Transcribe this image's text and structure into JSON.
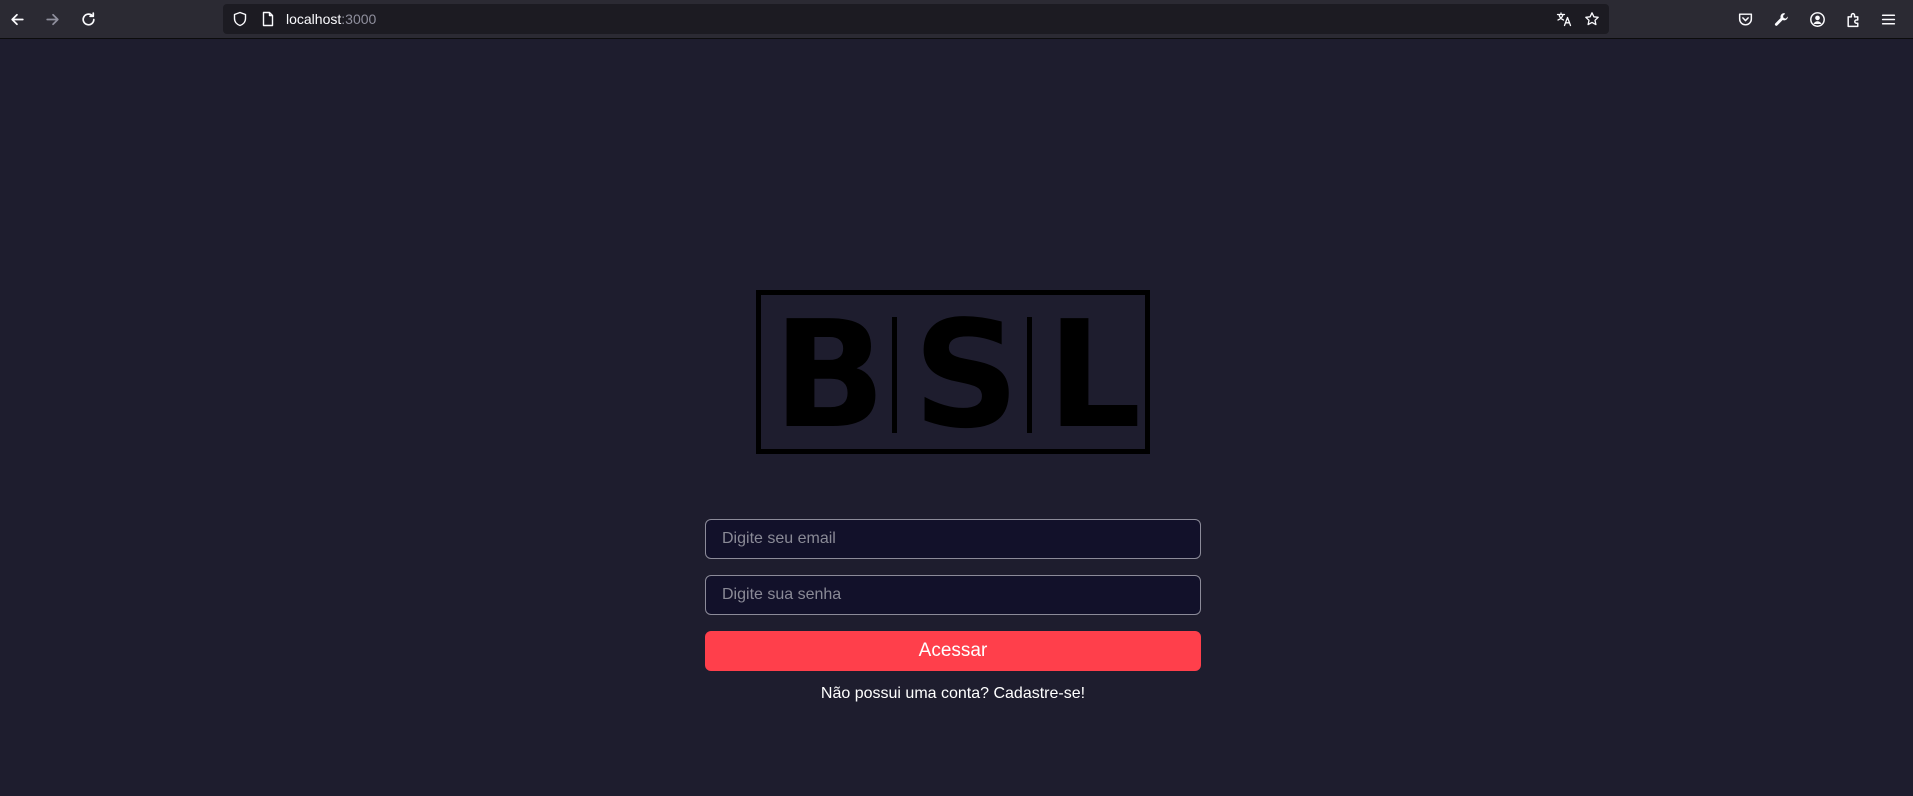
{
  "browser": {
    "url_host": "localhost",
    "url_port": ":3000",
    "icons": {
      "back": "arrow-left-icon",
      "forward": "arrow-right-icon",
      "reload": "reload-icon",
      "shield": "shield-icon",
      "page": "page-icon",
      "translate": "translate-icon",
      "bookmark": "star-icon",
      "pocket": "pocket-icon",
      "tools": "wrench-icon",
      "account": "account-icon",
      "extensions": "extensions-icon",
      "menu": "hamburger-menu-icon"
    }
  },
  "logo": {
    "letters": [
      "B",
      "S",
      "L"
    ]
  },
  "login": {
    "email_placeholder": "Digite seu email",
    "email_value": "",
    "password_placeholder": "Digite sua senha",
    "password_value": "",
    "submit_label": "Acessar",
    "signup_text": "Não possui uma conta? Cadastre-se!"
  },
  "colors": {
    "background": "#1e1d2e",
    "input_background": "#12112a",
    "accent": "#ff3f4b",
    "logo": "#000000"
  }
}
